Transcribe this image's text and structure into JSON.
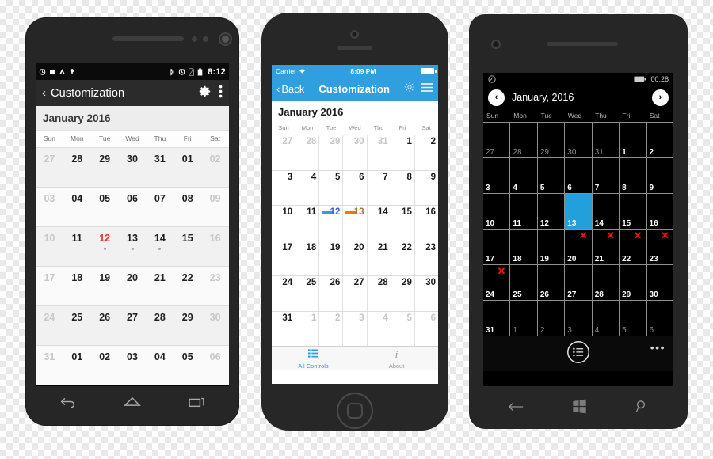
{
  "common": {
    "weekdays_short": [
      "Sun",
      "Mon",
      "Tue",
      "Wed",
      "Thu",
      "Fri",
      "Sat"
    ],
    "accent_blue": "#2f9fe0",
    "wp_accent": "#22a0dc",
    "today_red": "#e8312a",
    "orange": "#ef7612",
    "x_red": "#ef1111"
  },
  "android": {
    "status_bar": {
      "time": "8:12",
      "left_icons": [
        "alarm-icon",
        "stop-square-icon",
        "triangle-icon",
        "plug-icon"
      ],
      "right_icons": [
        "bluetooth-icon",
        "alarm-icon",
        "sim-card-icon",
        "battery-icon"
      ]
    },
    "app_bar": {
      "back_glyph": "‹",
      "title": "Customization",
      "icons": [
        "gear-icon",
        "overflow-menu-icon"
      ]
    },
    "calendar": {
      "month_label": "January 2016",
      "weekdays": [
        "Sun",
        "Mon",
        "Tue",
        "Wed",
        "Thu",
        "Fri",
        "Sat"
      ],
      "rows": [
        [
          {
            "d": "27",
            "o": true
          },
          {
            "d": "28"
          },
          {
            "d": "29"
          },
          {
            "d": "30"
          },
          {
            "d": "31"
          },
          {
            "d": "01"
          },
          {
            "d": "02",
            "o": true
          }
        ],
        [
          {
            "d": "03",
            "o": true
          },
          {
            "d": "04"
          },
          {
            "d": "05"
          },
          {
            "d": "06"
          },
          {
            "d": "07"
          },
          {
            "d": "08"
          },
          {
            "d": "09",
            "o": true
          }
        ],
        [
          {
            "d": "10",
            "o": true
          },
          {
            "d": "11"
          },
          {
            "d": "12",
            "today": true,
            "dot": true
          },
          {
            "d": "13",
            "dot": true
          },
          {
            "d": "14",
            "dot": true
          },
          {
            "d": "15"
          },
          {
            "d": "16",
            "o": true
          }
        ],
        [
          {
            "d": "17",
            "o": true
          },
          {
            "d": "18"
          },
          {
            "d": "19"
          },
          {
            "d": "20"
          },
          {
            "d": "21"
          },
          {
            "d": "22"
          },
          {
            "d": "23",
            "o": true
          }
        ],
        [
          {
            "d": "24",
            "o": true
          },
          {
            "d": "25"
          },
          {
            "d": "26"
          },
          {
            "d": "27"
          },
          {
            "d": "28"
          },
          {
            "d": "29"
          },
          {
            "d": "30",
            "o": true
          }
        ],
        [
          {
            "d": "31",
            "o": true
          },
          {
            "d": "01"
          },
          {
            "d": "02"
          },
          {
            "d": "03"
          },
          {
            "d": "04"
          },
          {
            "d": "05"
          },
          {
            "d": "06",
            "o": true
          }
        ]
      ]
    },
    "nav_bar": [
      "back-icon",
      "home-icon",
      "recents-icon"
    ]
  },
  "iphone": {
    "status_bar": {
      "carrier": "Carrier",
      "time": "8:09 PM",
      "icons": [
        "wifi-icon",
        "battery-icon"
      ]
    },
    "nav_bar": {
      "back_glyph": "‹",
      "back_label": "Back",
      "title": "Customization",
      "icons": [
        "gear-icon",
        "hamburger-menu-icon"
      ]
    },
    "calendar": {
      "month_label": "January 2016",
      "weekdays": [
        "Sun",
        "Mon",
        "Tue",
        "Wed",
        "Thu",
        "Fri",
        "Sat"
      ],
      "rows": [
        [
          {
            "d": "27",
            "o": true
          },
          {
            "d": "28",
            "o": true
          },
          {
            "d": "29",
            "o": true
          },
          {
            "d": "30",
            "o": true
          },
          {
            "d": "31",
            "o": true
          },
          {
            "d": "1"
          },
          {
            "d": "2"
          }
        ],
        [
          {
            "d": "3"
          },
          {
            "d": "4"
          },
          {
            "d": "5"
          },
          {
            "d": "6"
          },
          {
            "d": "7"
          },
          {
            "d": "8"
          },
          {
            "d": "9"
          }
        ],
        [
          {
            "d": "10"
          },
          {
            "d": "11"
          },
          {
            "d": "12",
            "sel": "blue"
          },
          {
            "d": "13",
            "sel": "orange"
          },
          {
            "d": "14"
          },
          {
            "d": "15"
          },
          {
            "d": "16"
          }
        ],
        [
          {
            "d": "17"
          },
          {
            "d": "18"
          },
          {
            "d": "19"
          },
          {
            "d": "20"
          },
          {
            "d": "21"
          },
          {
            "d": "22"
          },
          {
            "d": "23"
          }
        ],
        [
          {
            "d": "24"
          },
          {
            "d": "25"
          },
          {
            "d": "26"
          },
          {
            "d": "27"
          },
          {
            "d": "28"
          },
          {
            "d": "29"
          },
          {
            "d": "30"
          }
        ],
        [
          {
            "d": "31"
          },
          {
            "d": "1",
            "o": true
          },
          {
            "d": "2",
            "o": true
          },
          {
            "d": "3",
            "o": true
          },
          {
            "d": "4",
            "o": true
          },
          {
            "d": "5",
            "o": true
          },
          {
            "d": "6",
            "o": true
          }
        ]
      ]
    },
    "tab_bar": [
      {
        "label": "All Controls",
        "icon": "list-icon",
        "active": true
      },
      {
        "label": "About",
        "icon": "info-italic-icon",
        "active": false
      }
    ]
  },
  "wphone": {
    "status_bar": {
      "time": "00:28",
      "left_icon": "notification-icon",
      "right_icons": [
        "battery-icon"
      ]
    },
    "header": {
      "prev_glyph": "‹",
      "title": "January, 2016",
      "next_glyph": "›"
    },
    "calendar": {
      "weekdays": [
        "Sun",
        "Mon",
        "Tue",
        "Wed",
        "Thu",
        "Fri",
        "Sat"
      ],
      "rows": [
        [
          {
            "d": "27",
            "o": true
          },
          {
            "d": "28",
            "o": true
          },
          {
            "d": "29",
            "o": true
          },
          {
            "d": "30",
            "o": true
          },
          {
            "d": "31",
            "o": true
          },
          {
            "d": "1"
          },
          {
            "d": "2"
          }
        ],
        [
          {
            "d": "3"
          },
          {
            "d": "4"
          },
          {
            "d": "5"
          },
          {
            "d": "6"
          },
          {
            "d": "7"
          },
          {
            "d": "8"
          },
          {
            "d": "9"
          }
        ],
        [
          {
            "d": "10"
          },
          {
            "d": "11"
          },
          {
            "d": "12"
          },
          {
            "d": "13",
            "selected": true
          },
          {
            "d": "14"
          },
          {
            "d": "15"
          },
          {
            "d": "16"
          }
        ],
        [
          {
            "d": "17"
          },
          {
            "d": "18"
          },
          {
            "d": "19"
          },
          {
            "d": "20",
            "x": true
          },
          {
            "d": "21",
            "x": true
          },
          {
            "d": "22",
            "x": true
          },
          {
            "d": "23",
            "x": true
          }
        ],
        [
          {
            "d": "24",
            "x": true
          },
          {
            "d": "25"
          },
          {
            "d": "26"
          },
          {
            "d": "27"
          },
          {
            "d": "28"
          },
          {
            "d": "29"
          },
          {
            "d": "30"
          }
        ],
        [
          {
            "d": "31"
          },
          {
            "d": "1",
            "o": true
          },
          {
            "d": "2",
            "o": true
          },
          {
            "d": "3",
            "o": true
          },
          {
            "d": "4",
            "o": true
          },
          {
            "d": "5",
            "o": true
          },
          {
            "d": "6",
            "o": true
          }
        ]
      ]
    },
    "app_bar": {
      "icons": [
        "list-icon"
      ],
      "more_glyph": "•••"
    },
    "nav_bar": [
      "back-icon",
      "windows-start-icon",
      "search-icon"
    ]
  }
}
